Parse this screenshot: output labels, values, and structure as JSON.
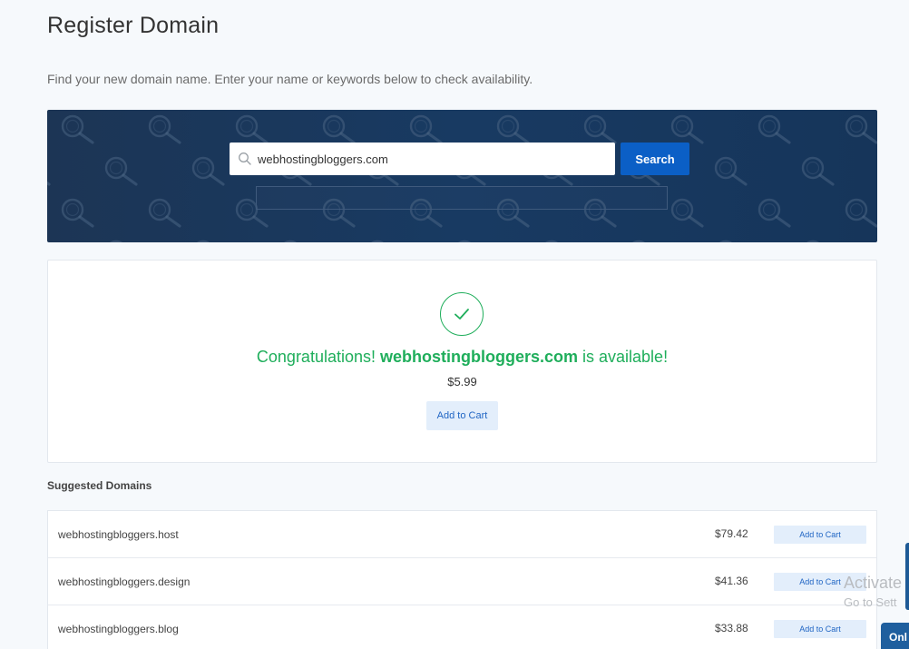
{
  "page": {
    "title": "Register Domain",
    "subtitle": "Find your new domain name. Enter your name or keywords below to check availability."
  },
  "search": {
    "value": "webhostingbloggers.com",
    "button_label": "Search",
    "icon": "search-icon",
    "banner_pattern_icon": "magnifier-icon"
  },
  "result": {
    "prefix": "Congratulations! ",
    "domain": "webhostingbloggers.com",
    "suffix": " is available!",
    "price": "$5.99",
    "add_to_cart_label": "Add to Cart",
    "status_icon": "check-circle-icon"
  },
  "suggested": {
    "heading": "Suggested Domains",
    "items": [
      {
        "name": "webhostingbloggers",
        "tld": ".host",
        "price": "$79.42",
        "cart_label": "Add to Cart"
      },
      {
        "name": "webhostingbloggers",
        "tld": ".design",
        "price": "$41.36",
        "cart_label": "Add to Cart"
      },
      {
        "name": "webhostingbloggers",
        "tld": ".blog",
        "price": "$33.88",
        "cart_label": "Add to Cart"
      }
    ]
  },
  "overlay": {
    "activate_line1": "Activate",
    "activate_line2": "Go to Sett",
    "chat_label": "Onl"
  },
  "colors": {
    "banner": "#183a62",
    "primary_button": "#0b5fc6",
    "success": "#1fae5b",
    "cart_button_bg": "#e3eefb",
    "cart_button_text": "#2166c4"
  }
}
